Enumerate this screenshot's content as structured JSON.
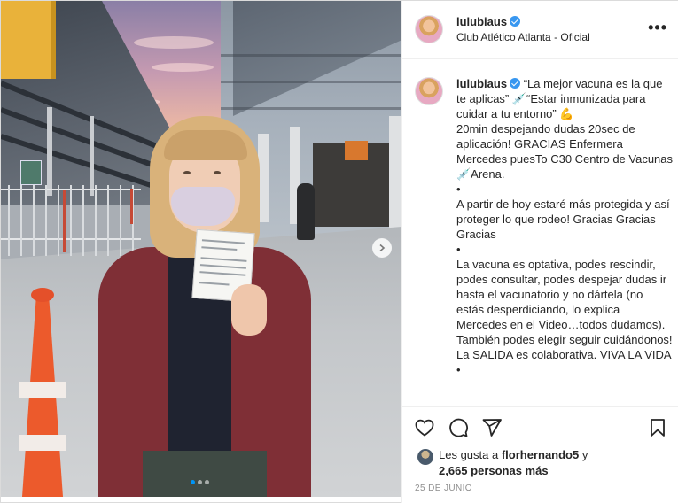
{
  "post": {
    "header": {
      "username": "lulubiaus",
      "location": "Club Atlético Atlanta - Oficial",
      "more_label": "•••"
    },
    "caption": {
      "username": "lulubiaus",
      "paragraphs": [
        "“La mejor vacuna es la que te aplicas” 💉“Estar inmunizada para cuidar a tu entorno” 💪",
        "20min despejando dudas 20sec de aplicación! GRACIAS Enfermera Mercedes puesTo C30 Centro de Vacunas 💉Arena.",
        "•",
        "A partir de hoy estaré más protegida y así proteger lo que rodeo! Gracias Gracias Gracias",
        "•",
        "La vacuna es optativa, podes rescindir, podes consultar, podes despejar dudas ir hasta el vacunatorio y no dártela (no estás desperdiciando, lo explica Mercedes en el Video…todos dudamos). También podes elegir seguir cuidándonos! La SALIDA es colaborativa. VIVA LA VIDA",
        "•"
      ]
    },
    "likes": {
      "prefix": "Les gusta a ",
      "liker": "florhernando5",
      "suffix": " y",
      "others": "2,665 personas más"
    },
    "date": "25 DE JUNIO",
    "carousel": {
      "count": 3,
      "active_index": 0
    },
    "icons": [
      "heart-icon",
      "comment-icon",
      "share-icon",
      "bookmark-icon",
      "chevron-right-icon",
      "verified-badge-icon"
    ],
    "colors": {
      "verified": "#3897f0",
      "carousel_active": "#0095f6",
      "muted_text": "#8e8e8e"
    }
  }
}
